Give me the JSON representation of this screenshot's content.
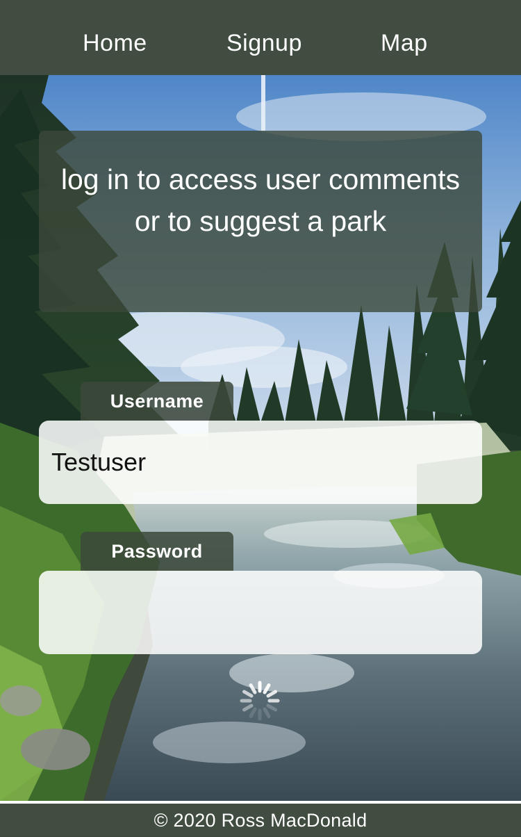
{
  "nav": {
    "home_label": "Home",
    "signup_label": "Signup",
    "map_label": "Map"
  },
  "message": {
    "text": "log in to access user comments or to suggest a park"
  },
  "form": {
    "username_label": "Username",
    "username_value": "Testuser",
    "password_label": "Password",
    "password_value": ""
  },
  "footer": {
    "text": "© 2020 Ross MacDonald"
  },
  "colors": {
    "bar": "#414d40",
    "overlay": "#3c483a",
    "text": "#ffffff"
  },
  "icons": {
    "loading": "loading-spinner-icon"
  }
}
